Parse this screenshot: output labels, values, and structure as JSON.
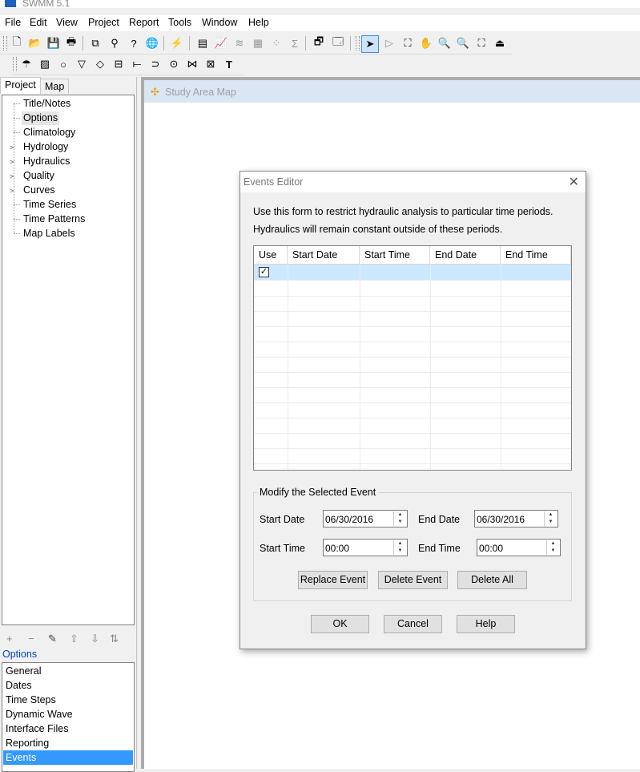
{
  "app": {
    "title": "SWMM 5.1"
  },
  "menu": [
    "File",
    "Edit",
    "View",
    "Project",
    "Report",
    "Tools",
    "Window",
    "Help"
  ],
  "left_panel": {
    "tabs": [
      {
        "label": "Project"
      },
      {
        "label": "Map"
      }
    ],
    "tree": [
      {
        "label": "Title/Notes",
        "expandable": false
      },
      {
        "label": "Options",
        "expandable": false
      },
      {
        "label": "Climatology",
        "expandable": false
      },
      {
        "label": "Hydrology",
        "expandable": true
      },
      {
        "label": "Hydraulics",
        "expandable": true
      },
      {
        "label": "Quality",
        "expandable": true
      },
      {
        "label": "Curves",
        "expandable": true
      },
      {
        "label": "Time Series",
        "expandable": false
      },
      {
        "label": "Time Patterns",
        "expandable": false
      },
      {
        "label": "Map Labels",
        "expandable": false
      }
    ],
    "section_title": "Options",
    "options": [
      "General",
      "Dates",
      "Time Steps",
      "Dynamic Wave",
      "Interface Files",
      "Reporting",
      "Events"
    ],
    "selected_option": "Events"
  },
  "map_window": {
    "title": "Study Area Map"
  },
  "dialog": {
    "title": "Events Editor",
    "line1": "Use this form to restrict hydraulic analysis to particular time periods.",
    "line2": "Hydraulics will remain constant outside of these periods.",
    "columns": [
      "Use",
      "Start Date",
      "Start Time",
      "End Date",
      "End Time"
    ],
    "rows": [
      {
        "use": true,
        "start_date": "",
        "start_time": "",
        "end_date": "",
        "end_time": ""
      }
    ],
    "group_title": "Modify the Selected Event",
    "start_date_label": "Start Date",
    "start_date": "06/30/2016",
    "end_date_label": "End Date",
    "end_date": "06/30/2016",
    "start_time_label": "Start Time",
    "start_time": "00:00",
    "end_time_label": "End Time",
    "end_time": "00:00",
    "replace_label": "Replace Event",
    "delete_label": "Delete Event",
    "delete_all_label": "Delete All",
    "ok_label": "OK",
    "cancel_label": "Cancel",
    "help_label": "Help",
    "close_glyph": "✕",
    "check_glyph": "✓"
  },
  "toolbar_icons": {
    "main": [
      "new-file-icon",
      "open-folder-icon",
      "save-icon",
      "print-icon",
      "copy-icon",
      "find-icon",
      "query-icon",
      "globe-icon",
      "run-icon",
      "report-icon",
      "graph-icon",
      "profile-icon",
      "table-icon",
      "scatter-icon",
      "statistics-icon",
      "properties-icon",
      "windows-icon",
      "select-arrow-icon",
      "vertex-icon",
      "region-icon",
      "pan-icon",
      "zoom-in-icon",
      "zoom-out-icon",
      "full-extent-icon",
      "measure-icon"
    ],
    "object": [
      "rain-gage-icon",
      "subcatchment-icon",
      "junction-icon",
      "outfall-icon",
      "divider-icon",
      "storage-icon",
      "conduit-icon",
      "pump-icon",
      "orifice-icon",
      "weir-icon",
      "outlet-icon",
      "label-icon"
    ]
  },
  "left_buttons": [
    "add-icon",
    "remove-icon",
    "edit-icon",
    "up-icon",
    "down-icon",
    "sort-icon"
  ]
}
